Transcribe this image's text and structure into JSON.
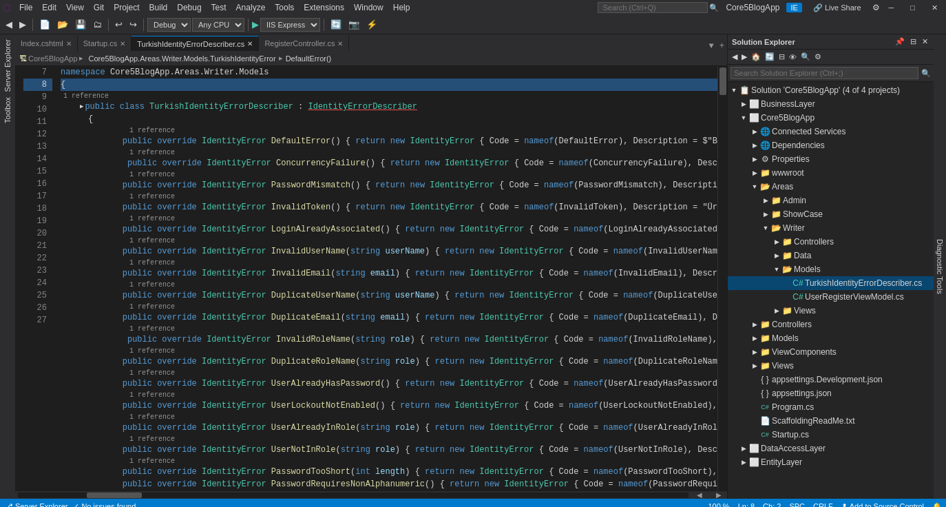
{
  "menubar": {
    "items": [
      "File",
      "Edit",
      "View",
      "Git",
      "Project",
      "Build",
      "Debug",
      "Test",
      "Analyze",
      "Tools",
      "Extensions",
      "Window",
      "Help"
    ],
    "search_placeholder": "Search (Ctrl+Q)",
    "app_title": "Core5BlogApp",
    "user_icon": "IE"
  },
  "toolbar": {
    "debug_mode": "Debug",
    "cpu": "Any CPU",
    "run_label": "IIS Express",
    "live_share": "Live Share"
  },
  "tabs": [
    {
      "label": "Index.cshtml",
      "active": false,
      "modified": false
    },
    {
      "label": "Startup.cs",
      "active": false,
      "modified": false
    },
    {
      "label": "TurkishIdentityErrorDescriber.cs",
      "active": true,
      "modified": true
    },
    {
      "label": "RegisterController.cs",
      "active": false,
      "modified": false
    }
  ],
  "path_bar": {
    "project": "Core5BlogApp",
    "path": "Core5BlogApp.Areas.Writer.Models.TurkishIdentityError",
    "method": "DefaultError()"
  },
  "code": {
    "lines": [
      {
        "num": 7,
        "indent": 0,
        "ref": false,
        "content": "namespace Core5BlogApp.Areas.Writer.Models",
        "tokens": [
          {
            "t": "kw",
            "v": "namespace"
          },
          {
            "t": "ns",
            "v": " Core5BlogApp.Areas.Writer.Models"
          }
        ]
      },
      {
        "num": 8,
        "indent": 0,
        "ref": false,
        "content": "{",
        "selected": true
      },
      {
        "num": 9,
        "indent": 1,
        "ref": true,
        "ref_text": "1 reference",
        "content": "    public class TurkishIdentityErrorDescriber : IdentityErrorDescriber"
      },
      {
        "num": 10,
        "indent": 1,
        "ref": false,
        "content": "    {"
      },
      {
        "num": 11,
        "indent": 2,
        "ref": true,
        "ref_text": "1 reference",
        "content": "        public override IdentityError DefaultError() { return new IdentityError { Code = nameof(DefaultError), Description = $\"B"
      },
      {
        "num": 12,
        "indent": 2,
        "ref": true,
        "ref_text": "1 reference",
        "content": "        public override IdentityError ConcurrencyFailure() { return new IdentityError { Code = nameof(ConcurrencyFailure), Desc"
      },
      {
        "num": 13,
        "indent": 2,
        "ref": true,
        "ref_text": "1 reference",
        "content": "        public override IdentityError PasswordMismatch() { return new IdentityError { Code = nameof(PasswordMismatch), Descripti"
      },
      {
        "num": 14,
        "indent": 2,
        "ref": true,
        "ref_text": "1 reference",
        "content": "        public override IdentityError InvalidToken() { return new IdentityError { Code = nameof(InvalidToken), Description = \"Ür"
      },
      {
        "num": 15,
        "indent": 2,
        "ref": true,
        "ref_text": "1 reference",
        "content": "        public override IdentityError LoginAlreadyAssociated() { return new IdentityError { Code = nameof(LoginAlreadyAssociated"
      },
      {
        "num": 16,
        "indent": 2,
        "ref": true,
        "ref_text": "1 reference",
        "content": "        public override IdentityError InvalidUserName(string userName) { return new IdentityError { Code = nameof(InvalidUserNam"
      },
      {
        "num": 17,
        "indent": 2,
        "ref": true,
        "ref_text": "1 reference",
        "content": "        public override IdentityError InvalidEmail(string email) { return new IdentityError { Code = nameof(InvalidEmail), Descr"
      },
      {
        "num": 18,
        "indent": 2,
        "ref": true,
        "ref_text": "1 reference",
        "content": "        public override IdentityError DuplicateUserName(string userName) { return new IdentityError { Code = nameof(DuplicateUse"
      },
      {
        "num": 19,
        "indent": 2,
        "ref": true,
        "ref_text": "1 reference",
        "content": "        public override IdentityError DuplicateEmail(string email) { return new IdentityError { Code = nameof(DuplicateEmail), D"
      },
      {
        "num": 20,
        "indent": 2,
        "ref": true,
        "ref_text": "1 reference",
        "content": "        public override IdentityError InvalidRoleName(string role) { return new IdentityError { Code = nameof(InvalidRoleName),"
      },
      {
        "num": 21,
        "indent": 2,
        "ref": true,
        "ref_text": "1 reference",
        "content": "        public override IdentityError DuplicateRoleName(string role) { return new IdentityError { Code = nameof(DuplicateRoleNam"
      },
      {
        "num": 22,
        "indent": 2,
        "ref": true,
        "ref_text": "1 reference",
        "content": "        public override IdentityError UserAlreadyHasPassword() { return new IdentityError { Code = nameof(UserAlreadyHasPassword"
      },
      {
        "num": 23,
        "indent": 2,
        "ref": true,
        "ref_text": "1 reference",
        "content": "        public override IdentityError UserLockoutNotEnabled() { return new IdentityError { Code = nameof(UserLockoutNotEnabled),"
      },
      {
        "num": 24,
        "indent": 2,
        "ref": true,
        "ref_text": "1 reference",
        "content": "        public override IdentityError UserAlreadyInRole(string role) { return new IdentityError { Code = nameof(UserAlreadyInRol"
      },
      {
        "num": 25,
        "indent": 2,
        "ref": true,
        "ref_text": "1 reference",
        "content": "        public override IdentityError UserNotInRole(string role) { return new IdentityError { Code = nameof(UserNotInRole), Desc"
      },
      {
        "num": 26,
        "indent": 2,
        "ref": true,
        "ref_text": "1 reference",
        "content": "        public override IdentityError PasswordTooShort(int length) { return new IdentityError { Code = nameof(PasswordTooShort),"
      },
      {
        "num": 27,
        "indent": 2,
        "ref": false,
        "content": "        public override IdentityError PasswordRequiresNonAlphanumeric() { return new IdentityError { Code = nameof(PasswordRequi"
      }
    ]
  },
  "solution_explorer": {
    "title": "Solution Explorer",
    "search_placeholder": "Search Solution Explorer (Ctrl+;)",
    "solution": {
      "label": "Solution 'Core5BlogApp' (4 of 4 projects)",
      "children": [
        {
          "label": "BusinessLayer",
          "icon": "folder",
          "expanded": false
        },
        {
          "label": "Core5BlogApp",
          "icon": "project",
          "expanded": true,
          "children": [
            {
              "label": "Connected Services",
              "icon": "connected-services",
              "expanded": false
            },
            {
              "label": "Dependencies",
              "icon": "dependencies",
              "expanded": false
            },
            {
              "label": "Properties",
              "icon": "properties",
              "expanded": false
            },
            {
              "label": "wwwroot",
              "icon": "folder",
              "expanded": false
            },
            {
              "label": "Areas",
              "icon": "folder",
              "expanded": true,
              "children": [
                {
                  "label": "Admin",
                  "icon": "folder",
                  "expanded": false
                },
                {
                  "label": "ShowCase",
                  "icon": "folder",
                  "expanded": false
                },
                {
                  "label": "Writer",
                  "icon": "folder",
                  "expanded": true,
                  "children": [
                    {
                      "label": "Controllers",
                      "icon": "folder",
                      "expanded": false
                    },
                    {
                      "label": "Data",
                      "icon": "folder",
                      "expanded": false
                    },
                    {
                      "label": "Models",
                      "icon": "folder",
                      "expanded": true,
                      "children": [
                        {
                          "label": "TurkishIdentityErrorDescriber.cs",
                          "icon": "cs-file",
                          "active": true
                        },
                        {
                          "label": "UserRegisterViewModel.cs",
                          "icon": "cs-file"
                        }
                      ]
                    },
                    {
                      "label": "Views",
                      "icon": "folder",
                      "expanded": false
                    }
                  ]
                }
              ]
            },
            {
              "label": "Controllers",
              "icon": "folder",
              "expanded": false
            },
            {
              "label": "Models",
              "icon": "folder",
              "expanded": false
            },
            {
              "label": "ViewComponents",
              "icon": "folder",
              "expanded": false
            },
            {
              "label": "Views",
              "icon": "folder",
              "expanded": false
            },
            {
              "label": "appsettings.Development.json",
              "icon": "json-file"
            },
            {
              "label": "appsettings.json",
              "icon": "json-file"
            },
            {
              "label": "Program.cs",
              "icon": "cs-file"
            },
            {
              "label": "ScaffoldingReadMe.txt",
              "icon": "txt-file"
            },
            {
              "label": "Startup.cs",
              "icon": "cs-file"
            }
          ]
        },
        {
          "label": "DataAccessLayer",
          "icon": "folder",
          "expanded": false
        },
        {
          "label": "EntityLayer",
          "icon": "folder",
          "expanded": false
        }
      ]
    }
  },
  "status_bar": {
    "git_branch": "Server Explorer",
    "status": "No issues found",
    "position": "Ln: 8",
    "col": "Ch: 2",
    "spaces": "SPC",
    "encoding": "CRLF",
    "zoom": "100 %",
    "source_control": "Add to Source Control",
    "notification_icon": "🔔"
  },
  "icons": {
    "solution": "📋",
    "folder_closed": "📁",
    "folder_open": "📂",
    "cs_file": "🔷",
    "json_file": "📄",
    "txt_file": "📄",
    "project": "🏗",
    "connected": "🌐",
    "deps": "📦",
    "props": "⚙",
    "collapse": "▶",
    "expand": "▼",
    "check": "✓",
    "error_icon": "⊘"
  }
}
